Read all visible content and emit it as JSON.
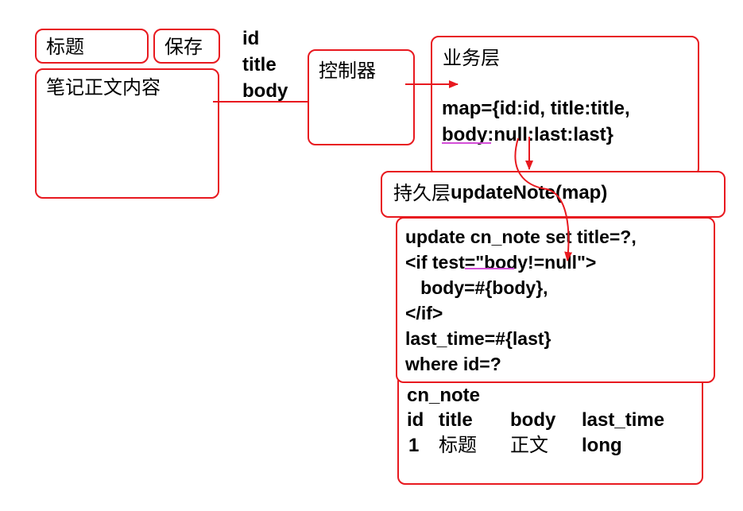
{
  "colors": {
    "border": "#e8191f",
    "arrow": "#e8191f",
    "squiggle": "#d44fd8"
  },
  "ui": {
    "title_field": "标题",
    "save_button": "保存",
    "body_field": "笔记正文内容"
  },
  "params": [
    "id",
    "title",
    "body"
  ],
  "controller": {
    "label": "控制器"
  },
  "service": {
    "label": "业务层",
    "map_line1": "map={id:id, title:title,",
    "map_line2": "body:null:last:last}"
  },
  "dao": {
    "prefix": "持久层",
    "method": "updateNote(map)"
  },
  "sql": {
    "lines": [
      "update cn_note set title=?,",
      "<if test=\"body!=null\">",
      "   body=#{body},",
      "</if>",
      "last_time=#{last}",
      "where id=?"
    ]
  },
  "table": {
    "name": "cn_note",
    "columns": [
      "id",
      "title",
      "body",
      "last_time"
    ],
    "row": [
      "1",
      "标题",
      "正文",
      "long"
    ]
  }
}
